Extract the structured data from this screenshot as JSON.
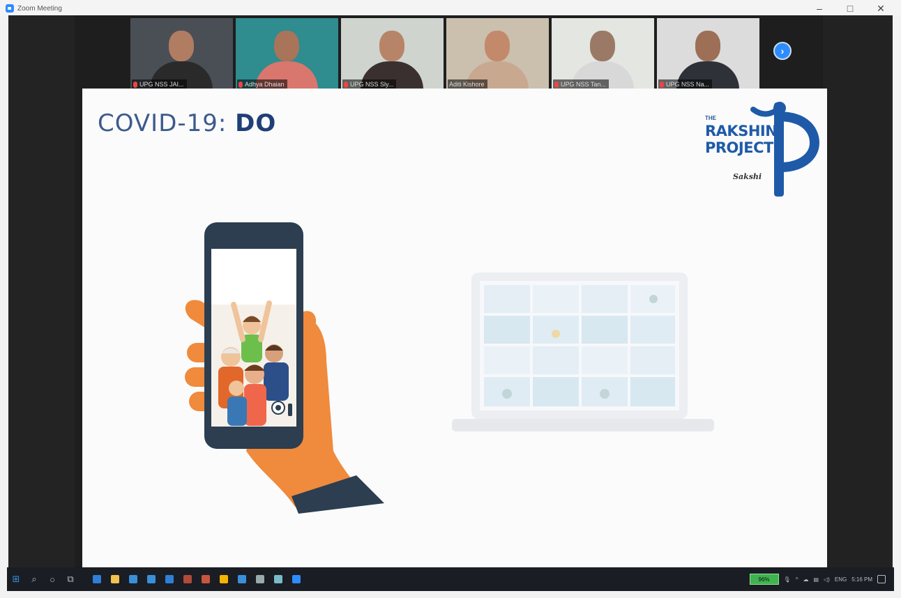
{
  "window": {
    "title": "Zoom Meeting",
    "controls": {
      "minimize": "–",
      "restore": "□",
      "close": "✕"
    }
  },
  "participants": [
    {
      "name": "UPG NSS JAI...",
      "mic_muted": true,
      "bg": "#4a4f55",
      "skin": "#b07d62",
      "shirt": "#2a2a2a"
    },
    {
      "name": "Adhya Dhaian",
      "mic_muted": true,
      "bg": "#2f8c8f",
      "skin": "#a8745a",
      "shirt": "#d9766e"
    },
    {
      "name": "UPG NSS Sly...",
      "mic_muted": true,
      "bg": "#cfd4cf",
      "skin": "#b88468",
      "shirt": "#3b3030"
    },
    {
      "name": "Aditi Kishore",
      "mic_muted": false,
      "bg": "#cbbfae",
      "skin": "#c28a6b",
      "shirt": "#c9a890"
    },
    {
      "name": "UPG NSS Tan...",
      "mic_muted": true,
      "bg": "#e3e6e1",
      "skin": "#9a7a66",
      "shirt": "#d8d8d8"
    },
    {
      "name": "UPG NSS Na...",
      "mic_muted": true,
      "bg": "#dcdcdc",
      "skin": "#9c6f56",
      "shirt": "#2e3138"
    }
  ],
  "next_page_icon": "chevron-right-icon",
  "slide": {
    "title_prefix": "COVID-19: ",
    "title_bold": "DO",
    "logo": {
      "line_small": "THE",
      "line_1": "RAKSHIN",
      "line_2": "PROJECT",
      "signature": "Sakshi"
    }
  },
  "taskbar": {
    "left_icons": [
      "windows-start-icon",
      "search-icon",
      "cortana-icon",
      "task-view-icon",
      "edge-icon",
      "file-explorer-icon",
      "store-icon",
      "mail-icon",
      "photos-icon",
      "app-icon",
      "app-icon",
      "chrome-icon",
      "app-icon",
      "app-icon",
      "app-icon",
      "zoom-icon"
    ],
    "battery": "96%",
    "language": "ENG",
    "time": "5:16 PM"
  },
  "colors": {
    "slide_title": "#3c5a8c",
    "logo_blue": "#1e5aa8",
    "zoom_blue": "#2d8cff"
  }
}
